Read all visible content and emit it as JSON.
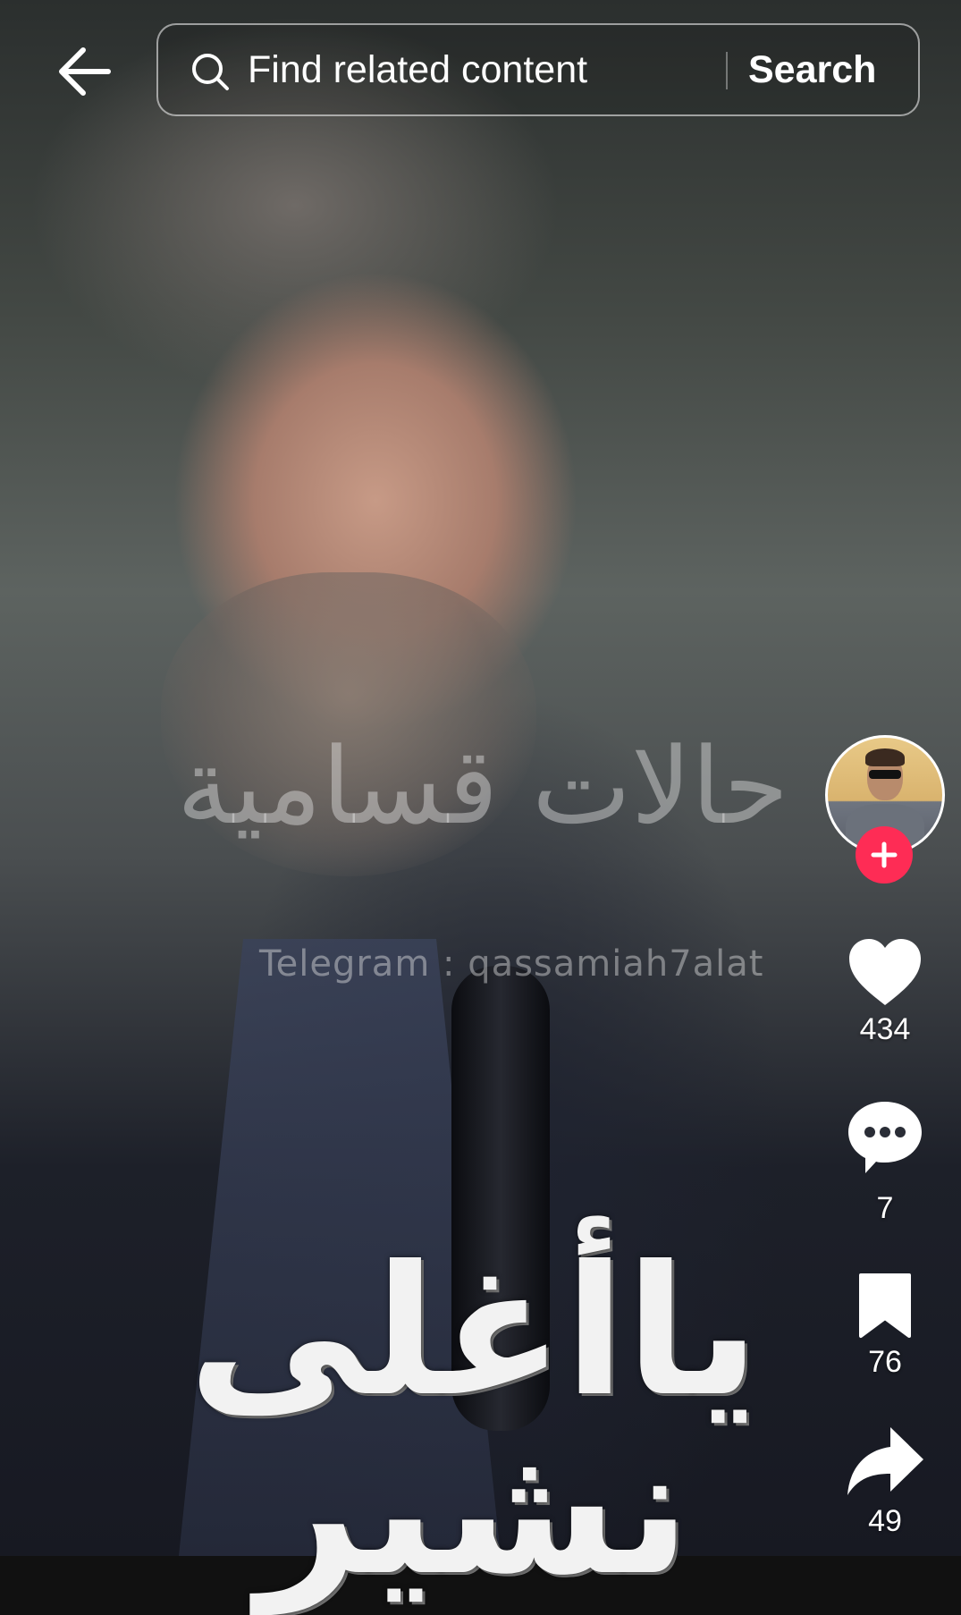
{
  "topbar": {
    "search_placeholder": "Find related content",
    "search_button": "Search"
  },
  "video": {
    "watermark_arabic": "حالات قسامية",
    "watermark_telegram": "Telegram : qassamiah7alat",
    "caption_arabic": "ياأغلى نشير"
  },
  "rail": {
    "likes": "434",
    "comments": "7",
    "saves": "76",
    "shares": "49"
  },
  "colors": {
    "follow_accent": "#fe2c55",
    "icon": "#ffffff"
  }
}
